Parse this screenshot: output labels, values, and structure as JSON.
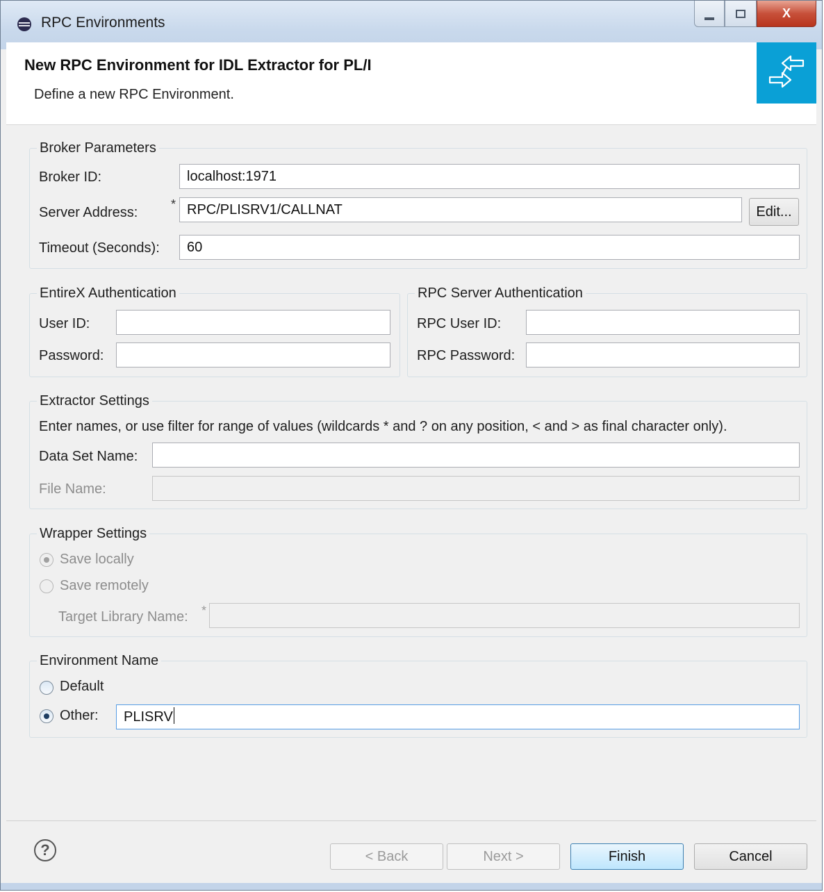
{
  "window": {
    "title": "RPC Environments",
    "controls": {
      "minimize": "minimize",
      "maximize": "maximize",
      "close": "X"
    }
  },
  "header": {
    "title": "New RPC Environment for IDL Extractor for PL/I",
    "subtitle": "Define a new RPC Environment."
  },
  "broker": {
    "legend": "Broker Parameters",
    "broker_id_label": "Broker ID:",
    "broker_id_value": "localhost:1971",
    "server_address_label": "Server Address:",
    "server_address_value": "RPC/PLISRV1/CALLNAT",
    "required_marker": "*",
    "edit_button": "Edit...",
    "timeout_label": "Timeout (Seconds):",
    "timeout_value": "60"
  },
  "entirex_auth": {
    "legend": "EntireX Authentication",
    "user_label": "User ID:",
    "user_value": "",
    "password_label": "Password:",
    "password_value": ""
  },
  "rpc_auth": {
    "legend": "RPC Server Authentication",
    "user_label": "RPC User ID:",
    "user_value": "",
    "password_label": "RPC Password:",
    "password_value": ""
  },
  "extractor": {
    "legend": "Extractor Settings",
    "hint": "Enter names, or use filter for range of values (wildcards * and ? on any position, < and > as final character only).",
    "dataset_label": "Data Set Name:",
    "dataset_value": "",
    "file_label": "File Name:",
    "file_value": ""
  },
  "wrapper": {
    "legend": "Wrapper Settings",
    "save_locally": "Save locally",
    "save_remotely": "Save remotely",
    "target_label": "Target Library Name:",
    "required_marker": "*",
    "target_value": ""
  },
  "environment": {
    "legend": "Environment Name",
    "default_label": "Default",
    "other_label": "Other:",
    "other_value": "PLISRV"
  },
  "footer": {
    "help": "?",
    "back": "< Back",
    "next": "Next >",
    "finish": "Finish",
    "cancel": "Cancel"
  }
}
